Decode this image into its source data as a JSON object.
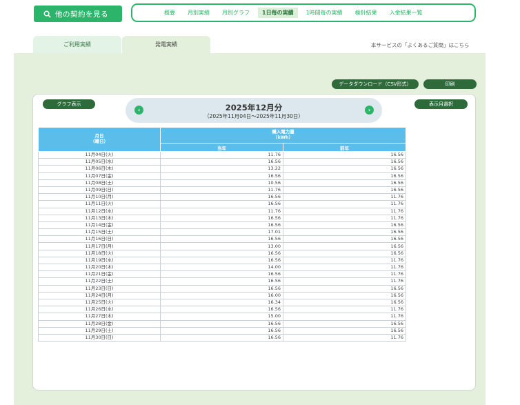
{
  "top": {
    "other_contract": "他の契約を見る",
    "nav": [
      {
        "label": "概要",
        "active": false
      },
      {
        "label": "月別実績",
        "active": false
      },
      {
        "label": "月別グラフ",
        "active": false
      },
      {
        "label": "1日毎の実績",
        "active": true
      },
      {
        "label": "1時間毎の実績",
        "active": false
      },
      {
        "label": "検針結果",
        "active": false
      },
      {
        "label": "入金結果一覧",
        "active": false
      }
    ]
  },
  "tabs": {
    "usage": "ご利用実績",
    "generation": "発電実績"
  },
  "faq_link": "本サービスの「よくあるご質問」はこちら",
  "buttons": {
    "csv": "データダウンロード（CSV形式）",
    "print": "印刷",
    "graph": "グラフ表示",
    "month_select": "表示月選択"
  },
  "period": {
    "title": "2025年12月分",
    "range": "（2025年11月04日～2025年11月30日）"
  },
  "table": {
    "date_header": [
      "月日",
      "（曜日）"
    ],
    "kwh_header": [
      "購入電力量",
      "（kWh）"
    ],
    "col_current": "当年",
    "col_previous": "前年",
    "rows": [
      {
        "date": "11月04日(火)",
        "cur": "11.76",
        "prev": "16.56"
      },
      {
        "date": "11月05日(水)",
        "cur": "16.56",
        "prev": "16.56"
      },
      {
        "date": "11月06日(木)",
        "cur": "13.22",
        "prev": "16.56"
      },
      {
        "date": "11月07日(金)",
        "cur": "16.56",
        "prev": "16.56"
      },
      {
        "date": "11月08日(土)",
        "cur": "10.56",
        "prev": "16.56"
      },
      {
        "date": "11月09日(日)",
        "cur": "11.76",
        "prev": "16.56"
      },
      {
        "date": "11月10日(月)",
        "cur": "16.56",
        "prev": "11.76"
      },
      {
        "date": "11月11日(火)",
        "cur": "16.56",
        "prev": "11.76"
      },
      {
        "date": "11月12日(水)",
        "cur": "11.76",
        "prev": "11.76"
      },
      {
        "date": "11月13日(木)",
        "cur": "16.56",
        "prev": "11.76"
      },
      {
        "date": "11月14日(金)",
        "cur": "16.56",
        "prev": "16.56"
      },
      {
        "date": "11月15日(土)",
        "cur": "17.01",
        "prev": "16.56"
      },
      {
        "date": "11月16日(日)",
        "cur": "16.56",
        "prev": "16.56"
      },
      {
        "date": "11月17日(月)",
        "cur": "13.00",
        "prev": "16.56"
      },
      {
        "date": "11月18日(火)",
        "cur": "16.56",
        "prev": "16.56"
      },
      {
        "date": "11月19日(水)",
        "cur": "16.56",
        "prev": "11.76"
      },
      {
        "date": "11月20日(木)",
        "cur": "14.00",
        "prev": "11.76"
      },
      {
        "date": "11月21日(金)",
        "cur": "16.56",
        "prev": "11.76"
      },
      {
        "date": "11月22日(土)",
        "cur": "16.56",
        "prev": "11.76"
      },
      {
        "date": "11月23日(日)",
        "cur": "16.56",
        "prev": "16.56"
      },
      {
        "date": "11月24日(月)",
        "cur": "16.00",
        "prev": "16.56"
      },
      {
        "date": "11月25日(火)",
        "cur": "16.34",
        "prev": "16.56"
      },
      {
        "date": "11月26日(水)",
        "cur": "16.56",
        "prev": "11.76"
      },
      {
        "date": "11月27日(木)",
        "cur": "15.00",
        "prev": "11.76"
      },
      {
        "date": "11月28日(金)",
        "cur": "16.56",
        "prev": "16.56"
      },
      {
        "date": "11月29日(土)",
        "cur": "16.56",
        "prev": "16.56"
      },
      {
        "date": "11月30日(日)",
        "cur": "16.56",
        "prev": "11.76"
      }
    ]
  },
  "colors": {
    "accent": "#2cb56a",
    "dark_button": "#2f6a3b",
    "header": "#5bbde9",
    "panel": "#e4f0dc"
  }
}
